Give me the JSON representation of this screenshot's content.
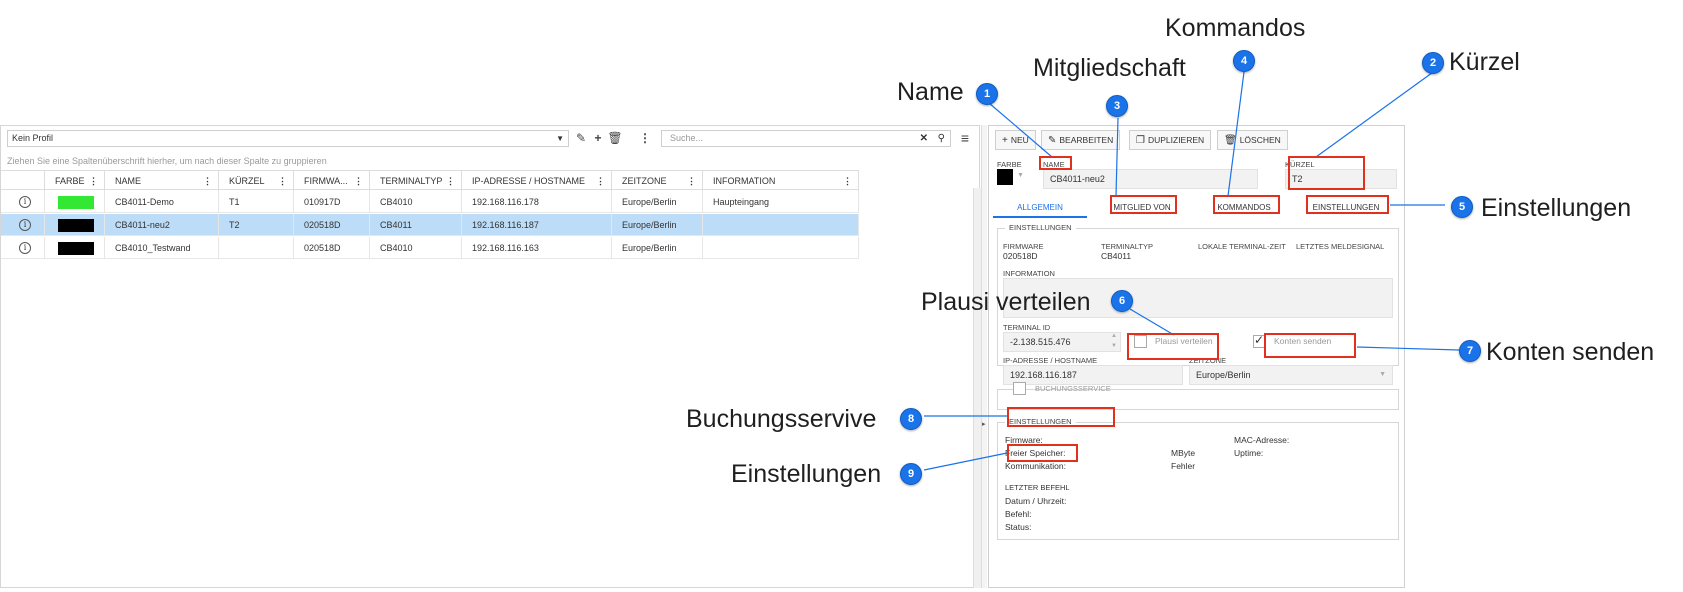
{
  "annotations": [
    {
      "num": "1",
      "label": "Name"
    },
    {
      "num": "2",
      "label": "Kürzel"
    },
    {
      "num": "3",
      "label": "Mitgliedschaft"
    },
    {
      "num": "4",
      "label": "Kommandos"
    },
    {
      "num": "5",
      "label": "Einstellungen"
    },
    {
      "num": "6",
      "label": "Plausi verteilen"
    },
    {
      "num": "7",
      "label": "Konten senden"
    },
    {
      "num": "8",
      "label": "Buchungsservive"
    },
    {
      "num": "9",
      "label": "Einstellungen"
    }
  ],
  "toolbar": {
    "profile": "Kein Profil",
    "search_placeholder": "Suche..."
  },
  "grid": {
    "group_hint": "Ziehen Sie eine Spaltenüberschrift hierher, um nach dieser Spalte zu gruppieren",
    "columns": [
      "FARBE",
      "NAME",
      "KÜRZEL",
      "FIRMWA...",
      "TERMINALTYP",
      "IP-ADRESSE / HOSTNAME",
      "ZEITZONE",
      "INFORMATION"
    ],
    "rows": [
      {
        "color": "#33e833",
        "name": "CB4011-Demo",
        "kuerzel": "T1",
        "firmware": "010917D",
        "typ": "CB4010",
        "ip": "192.168.116.178",
        "zone": "Europe/Berlin",
        "info": "Haupteingang"
      },
      {
        "color": "#000000",
        "name": "CB4011-neu2",
        "kuerzel": "T2",
        "firmware": "020518D",
        "typ": "CB4011",
        "ip": "192.168.116.187",
        "zone": "Europe/Berlin",
        "info": ""
      },
      {
        "color": "#000000",
        "name": "CB4010_Testwand",
        "kuerzel": "",
        "firmware": "020518D",
        "typ": "CB4010",
        "ip": "192.168.116.163",
        "zone": "Europe/Berlin",
        "info": ""
      }
    ]
  },
  "detail": {
    "buttons": {
      "new": "NEU",
      "edit": "BEARBEITEN",
      "duplicate": "DUPLIZIEREN",
      "delete": "LÖSCHEN"
    },
    "farbe_label": "FARBE",
    "name_label": "NAME",
    "name_value": "CB4011-neu2",
    "kuerzel_label": "KÜRZEL",
    "kuerzel_value": "T2",
    "tabs": [
      "ALLGEMEIN",
      "MITGLIED VON",
      "KOMMANDOS",
      "EINSTELLUNGEN"
    ],
    "settings_legend": "EINSTELLUNGEN",
    "firmware_label": "FIRMWARE",
    "firmware_value": "020518D",
    "terminaltyp_label": "TERMINALTYP",
    "terminaltyp_value": "CB4011",
    "lokale_zeit_label": "LOKALE TERMINAL-ZEIT",
    "meldesignal_label": "LETZTES MELDESIGNAL",
    "information_label": "INFORMATION",
    "terminal_id_label": "TERMINAL ID",
    "terminal_id_value": "-2.138.515.476",
    "plausi_label": "Plausi verteilen",
    "konten_label": "Konten senden",
    "ip_label": "IP-ADRESSE / HOSTNAME",
    "ip_value": "192.168.116.187",
    "zeitzone_label": "ZEITZONE",
    "zeitzone_value": "Europe/Berlin",
    "buchungsservice_label": "BUCHUNGSSERVICE",
    "einstellungen2_legend": "EINSTELLUNGEN",
    "status": {
      "firmware": "Firmware:",
      "mac": "MAC-Adresse:",
      "speicher": "Freier Speicher:",
      "mbyte": "MByte",
      "uptime": "Uptime:",
      "kommunikation": "Kommunikation:",
      "fehler": "Fehler",
      "letzter_befehl": "LETZTER BEFEHL",
      "datum": "Datum / Uhrzeit:",
      "befehl": "Befehl:",
      "status": "Status:"
    }
  }
}
